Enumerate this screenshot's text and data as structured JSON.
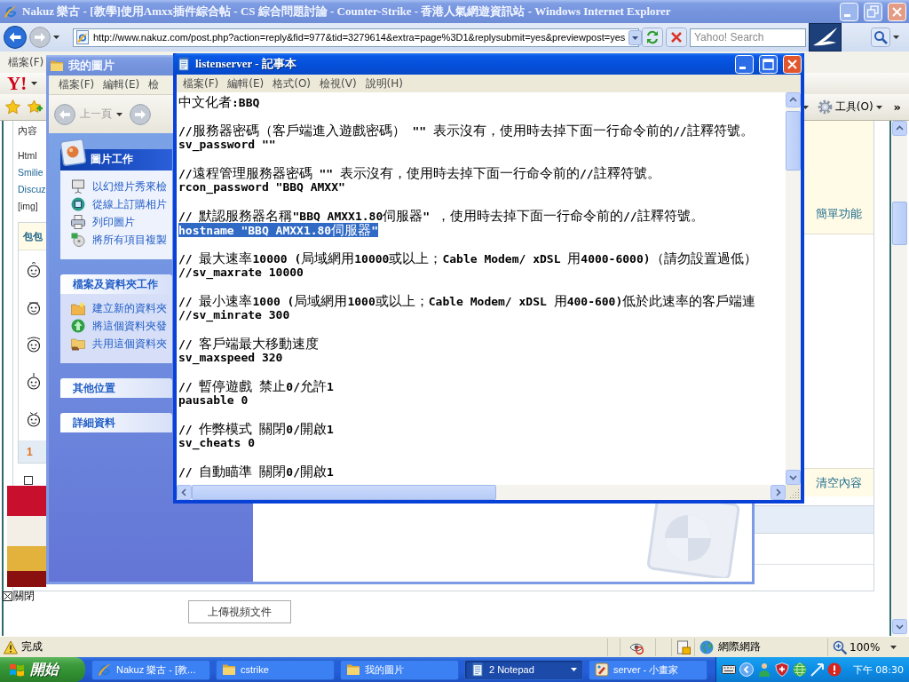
{
  "browser": {
    "title": "Nakuz 樂古 - [教學]使用Amxx插件綜合帖 - CS 綜合問題討論 - Counter-Strike - 香港人氣網遊資訊站 - Windows Internet Explorer",
    "active": false,
    "back": {
      "disabled": false
    },
    "forward": {
      "disabled": true
    },
    "address": "http://www.nakuz.com/post.php?action=reply&fid=977&tid=3279614&extra=page%3D1&replysubmit=yes&previewpost=yes",
    "search": {
      "placeholder": "Yahoo! Search"
    },
    "menu": [
      "檔案(F)"
    ],
    "toolbar_logo": "Y!",
    "command_bar": {
      "tools": "工具(O)",
      "more": "»"
    },
    "status_bar": {
      "text": "完成",
      "zone": "網際網路",
      "zoom": "100%"
    }
  },
  "page": {
    "form_labels": [
      {
        "text": "內容",
        "kind": "text"
      },
      {
        "text": "Html",
        "kind": "text"
      },
      {
        "text": "Smilie",
        "kind": "link"
      },
      {
        "text": "Discuz",
        "kind": "link"
      },
      {
        "text": "[img]",
        "kind": "text"
      }
    ],
    "smilies": {
      "header": "包包",
      "pages": [
        {
          "label": "1",
          "selected": true
        }
      ]
    },
    "option_checkbox": {
      "checked": false
    },
    "side_links": [
      "簡單功能",
      "清空內容"
    ],
    "ad": {
      "close": "關閉"
    },
    "upload_button": "上傳視頻文件"
  },
  "explorer": {
    "title": "我的圖片",
    "active": false,
    "menu": [
      "檔案(F)",
      "編輯(E)",
      "檢"
    ],
    "back": {
      "label": "上一頁",
      "disabled": true
    },
    "forward": {
      "disabled": true
    },
    "panels": [
      {
        "title": "圖片工作",
        "kind": "special",
        "expanded": true,
        "items": [
          {
            "label": "以幻燈片秀來檢",
            "kind": "slideshow"
          },
          {
            "label": "從線上訂購相片",
            "kind": "order"
          },
          {
            "label": "列印圖片",
            "kind": "print"
          },
          {
            "label": "將所有項目複製",
            "kind": "copy"
          }
        ]
      },
      {
        "title": "檔案及資料夾工作",
        "kind": "normal",
        "expanded": true,
        "items": [
          {
            "label": "建立新的資料夾",
            "kind": "new-folder"
          },
          {
            "label": "將這個資料夾發",
            "kind": "publish"
          },
          {
            "label": "共用這個資料夾",
            "kind": "share"
          }
        ]
      },
      {
        "title": "其他位置",
        "kind": "normal",
        "expanded": false
      },
      {
        "title": "詳細資料",
        "kind": "normal",
        "expanded": false
      }
    ]
  },
  "notepad": {
    "title": "listenserver - 記事本",
    "active": true,
    "menu": [
      "檔案(F)",
      "編輯(E)",
      "格式(O)",
      "檢視(V)",
      "說明(H)"
    ],
    "paragraphs": [
      {
        "lines": [
          {
            "text": "中文化者:BBQ",
            "selected": false
          }
        ]
      },
      {
        "lines": [
          {
            "text": "//服務器密碼（客戶端進入遊戲密碼） \"\" 表示沒有，使用時去掉下面一行命令前的//註釋符號。",
            "selected": false
          },
          {
            "text": "sv_password \"\"",
            "selected": false
          }
        ]
      },
      {
        "lines": [
          {
            "text": "//遠程管理服務器密碼 \"\" 表示沒有，使用時去掉下面一行命令前的//註釋符號。",
            "selected": false
          },
          {
            "text": "rcon_password \"BBQ AMXX\"",
            "selected": false
          }
        ]
      },
      {
        "lines": [
          {
            "text": "// 默認服務器名稱\"BBQ AMXX1.80伺服器\" ，使用時去掉下面一行命令前的//註釋符號。",
            "selected": false
          },
          {
            "text": "hostname \"BBQ AMXX1.80伺服器\"",
            "selected": true
          }
        ]
      },
      {
        "lines": [
          {
            "text": "// 最大速率10000 (局域網用10000或以上；Cable Modem/ xDSL 用4000-6000)（請勿設置過低）",
            "selected": false
          },
          {
            "text": "//sv_maxrate 10000",
            "selected": false
          }
        ]
      },
      {
        "lines": [
          {
            "text": "// 最小速率1000 (局域網用1000或以上；Cable Modem/ xDSL 用400-600)低於此速率的客戶端連",
            "selected": false
          },
          {
            "text": "//sv_minrate 300",
            "selected": false
          }
        ]
      },
      {
        "lines": [
          {
            "text": "// 客戶端最大移動速度",
            "selected": false
          },
          {
            "text": "sv_maxspeed 320",
            "selected": false
          }
        ]
      },
      {
        "lines": [
          {
            "text": "// 暫停遊戲 禁止0/允許1",
            "selected": false
          },
          {
            "text": "pausable 0",
            "selected": false
          }
        ]
      },
      {
        "lines": [
          {
            "text": "// 作弊模式 關閉0/開啟1",
            "selected": false
          },
          {
            "text": "sv_cheats 0",
            "selected": false
          }
        ]
      },
      {
        "lines": [
          {
            "text": "// 自動瞄準 關閉0/開啟1",
            "selected": false
          }
        ]
      }
    ]
  },
  "taskbar": {
    "start": "開始",
    "tasks": [
      {
        "label": "Nakuz 樂古 - [教...",
        "kind": "browser",
        "selected": false,
        "grouped": false
      },
      {
        "label": "cstrike",
        "kind": "folder",
        "selected": false,
        "grouped": false
      },
      {
        "label": "我的圖片",
        "kind": "folder",
        "selected": false,
        "grouped": false
      },
      {
        "label": "2 Notepad",
        "kind": "notepad",
        "selected": true,
        "grouped": true
      },
      {
        "label": "server - 小畫家",
        "kind": "paint",
        "selected": false,
        "grouped": false
      }
    ],
    "clock": "下午 08:30"
  }
}
